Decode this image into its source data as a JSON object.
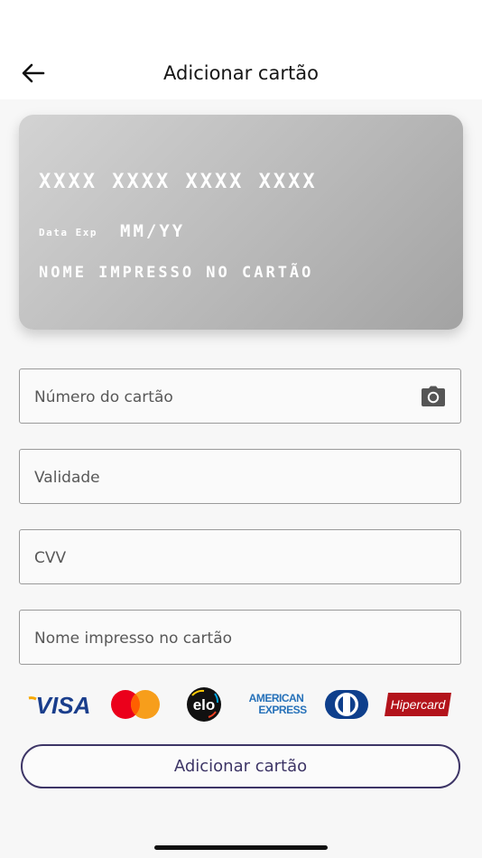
{
  "header": {
    "title": "Adicionar cartão"
  },
  "card_preview": {
    "number": "XXXX XXXX XXXX XXXX",
    "exp_label": "Data Exp",
    "exp_value": "MM/YY",
    "name": "NOME IMPRESSO NO CARTÃO"
  },
  "form": {
    "card_number_placeholder": "Número do cartão",
    "validity_placeholder": "Validade",
    "cvv_placeholder": "CVV",
    "name_placeholder": "Nome impresso no cartão"
  },
  "brands": {
    "visa": "VISA",
    "elo": "elo",
    "amex_line1": "AMERICAN",
    "amex_line2": "EXPRESS",
    "hipercard": "Hipercard"
  },
  "actions": {
    "add_label": "Adicionar cartão"
  },
  "colors": {
    "accent": "#3d3566",
    "card_gray": "#b9b9b9"
  },
  "icons": {
    "back": "arrow-left-icon",
    "camera": "camera-icon"
  }
}
